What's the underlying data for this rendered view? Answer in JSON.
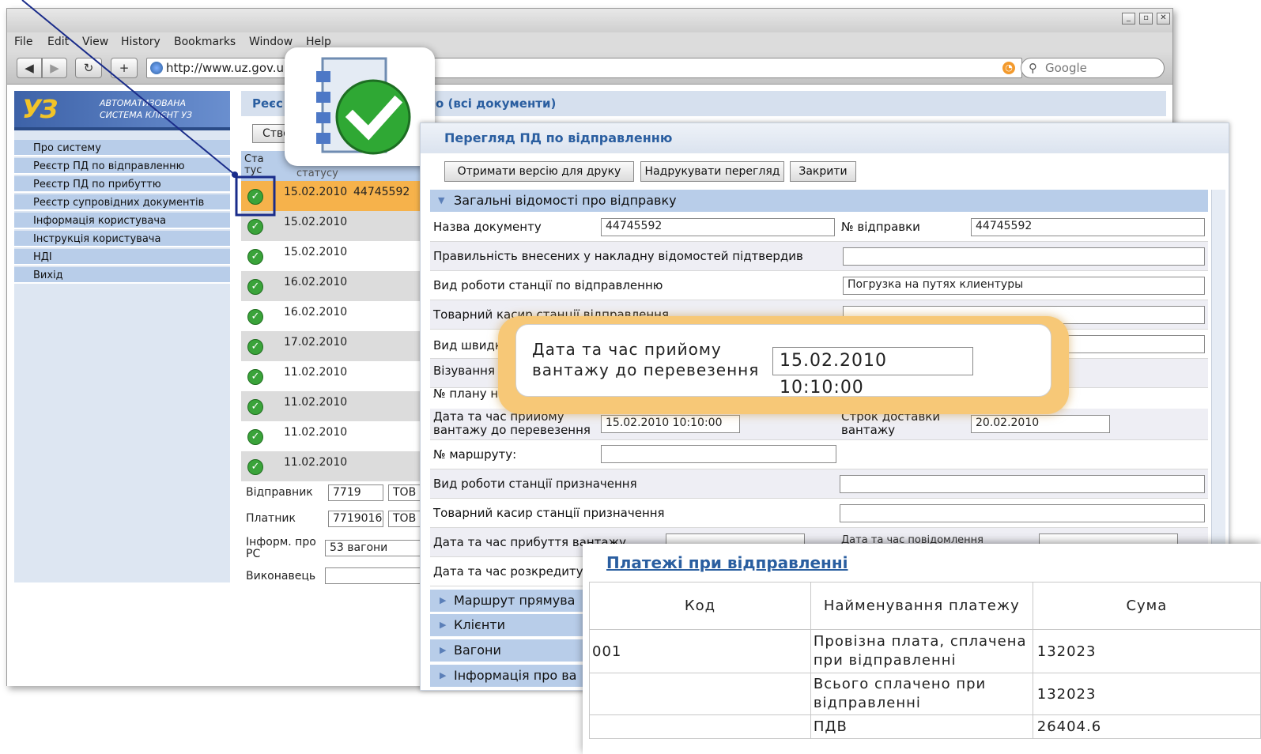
{
  "browser": {
    "menu": [
      "File",
      "Edit",
      "View",
      "History",
      "Bookmarks",
      "Window",
      "Help"
    ],
    "url": "http://www.uz.gov.u",
    "search_placeholder": "Google"
  },
  "app": {
    "logo_letters": "УЗ",
    "logo_text": "АВТОМАТИЗОВАНА СИСТЕМА КЛІЄНТ УЗ",
    "sidebar": [
      "Про систему",
      "Реєстр ПД по відправленню",
      "Реєстр ПД по прибуттю",
      "Реєстр супровідних документів",
      "Інформація користувача",
      "Інструкція користувача",
      "НДІ",
      "Вихід"
    ],
    "register_title": "Реєс",
    "register_suffix": "о (всі документи)",
    "create_button": "Ство",
    "col_status": "Ста тус",
    "col_status_date": "статусу",
    "rows": [
      {
        "date": "15.02.2010",
        "num": "44745592"
      },
      {
        "date": "15.02.2010",
        "num": ""
      },
      {
        "date": "15.02.2010",
        "num": ""
      },
      {
        "date": "16.02.2010",
        "num": ""
      },
      {
        "date": "16.02.2010",
        "num": ""
      },
      {
        "date": "17.02.2010",
        "num": ""
      },
      {
        "date": "11.02.2010",
        "num": ""
      },
      {
        "date": "11.02.2010",
        "num": ""
      },
      {
        "date": "11.02.2010",
        "num": ""
      },
      {
        "date": "11.02.2010",
        "num": ""
      }
    ],
    "sender_label": "Відправник",
    "sender_code": "7719",
    "sender_name": "ТОВ Т",
    "payer_label": "Платник",
    "payer_code": "7719016",
    "payer_name": "ТОВ Т",
    "rs_label": "Інформ. про РС",
    "rs_value": "53 вагони",
    "executor_label": "Виконавець"
  },
  "dialog": {
    "title": "Перегляд ПД по відправленню",
    "buttons": [
      "Отримати версію для друку",
      "Надрукувати перегляд",
      "Закрити"
    ],
    "section": "Загальні відомості про відправку",
    "doc_name_label": "Назва документу",
    "doc_name": "44745592",
    "ship_no_label": "№ відправки",
    "ship_no": "44745592",
    "confirm_label": "Правильність внесених у накладну відомостей підтвердив",
    "work_label": "Вид роботи станції по відправленню",
    "work_value": "Погрузка на путях клиентуры",
    "cashier_label": "Товарний касир станції відправлення",
    "speed_label": "Вид швидк",
    "visa_label": "Візування",
    "plan_label": "№ плану на",
    "accept_label": "Дата та час прийому вантажу до перевезення",
    "accept_value": "15.02.2010 10:10:00",
    "delivery_label": "Строк доставки вантажу",
    "delivery_value": "20.02.2010",
    "route_label": "№ маршруту:",
    "dest_work_label": "Вид роботи станції призначення",
    "dest_cashier_label": "Товарний касир станції призначення",
    "arrival_label": "Дата та час прибуття вантажу",
    "notify_label": "Дата та час повідомлення",
    "uncredit_label": "Дата та час розкредиту",
    "collapsed": [
      "Маршрут прямува",
      "Клієнти",
      "Вагони",
      "Інформація про ва"
    ]
  },
  "callout": {
    "label": "Дата та час прийому вантажу до перевезення",
    "value": "15.02.2010 10:10:00"
  },
  "payments": {
    "title": "Платежі при відправленні",
    "headers": [
      "Код",
      "Найменування платежу",
      "Сума"
    ],
    "rows": [
      {
        "code": "001",
        "name": "Провізна плата, сплачена при відправленні",
        "sum": "132023"
      },
      {
        "code": "",
        "name": "Всього сплачено при відправленні",
        "sum": "132023"
      },
      {
        "code": "",
        "name": "ПДВ",
        "sum": "26404.6"
      }
    ]
  },
  "colors": {
    "accent": "#2a5ea0",
    "selected_row": "#f6b24b",
    "nav_item": "#b8cde9",
    "callout": "#f7c877"
  }
}
